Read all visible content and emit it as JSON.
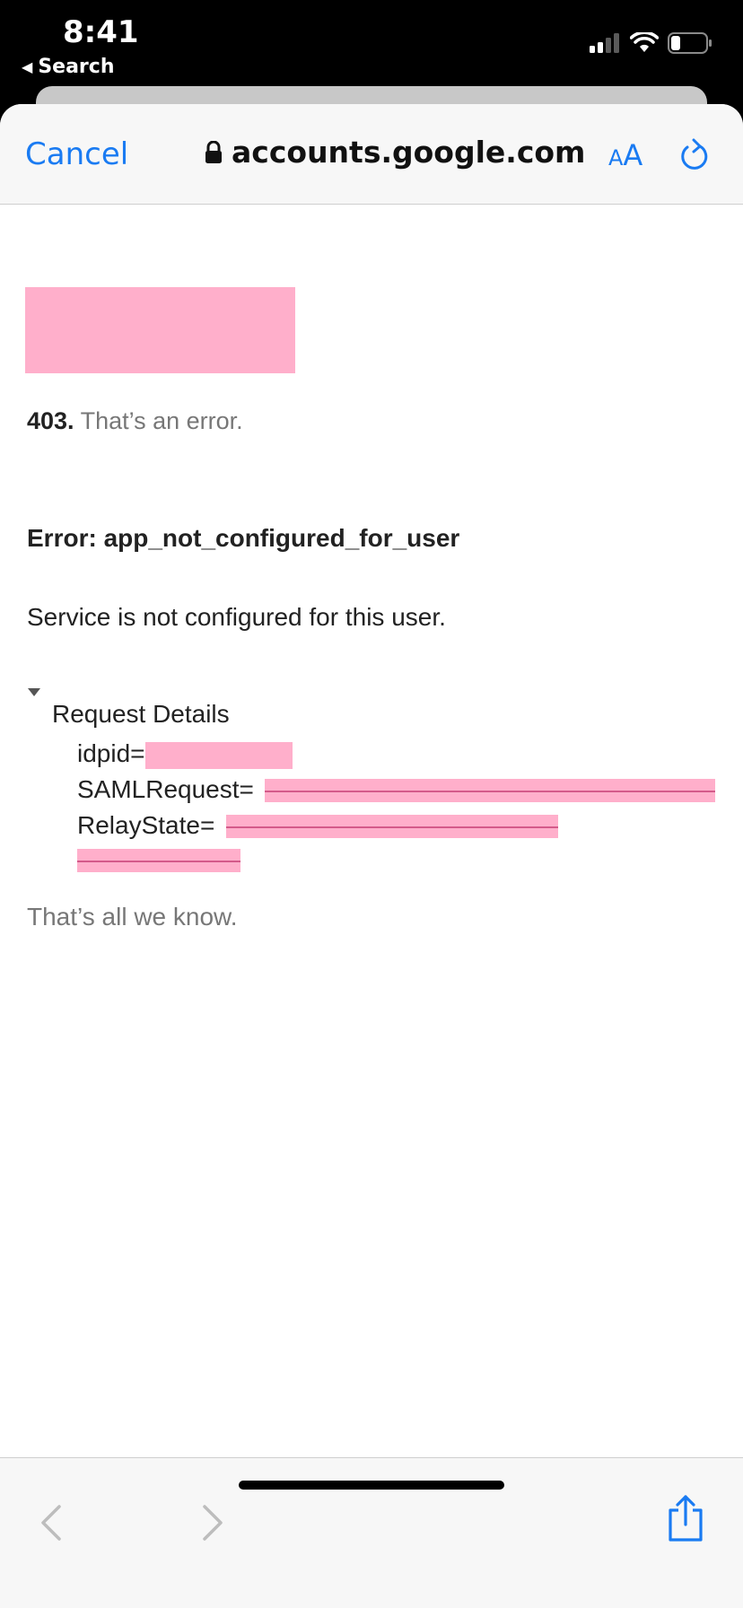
{
  "status_bar": {
    "time": "8:41",
    "back_label": "Search"
  },
  "nav": {
    "cancel_label": "Cancel",
    "url": "accounts.google.com",
    "aa_small": "A",
    "aa_big": "A"
  },
  "page": {
    "error_code": "403.",
    "error_code_text": "That’s an error.",
    "error_title": "Error: app_not_configured_for_user",
    "error_message": "Service is not configured for this user.",
    "details_label": "Request Details",
    "idpid_key": "idpid=",
    "saml_key": "SAMLRequest=",
    "relay_key": "RelayState=",
    "footer_text": "That’s all we know."
  },
  "colors": {
    "accent": "#1a7bf2",
    "redaction": "#ffafcb"
  },
  "icons": [
    "lock-icon",
    "reload-icon",
    "back-arrow-icon",
    "forward-arrow-icon",
    "share-icon",
    "wifi-icon",
    "battery-icon",
    "cellular-signal-icon"
  ]
}
